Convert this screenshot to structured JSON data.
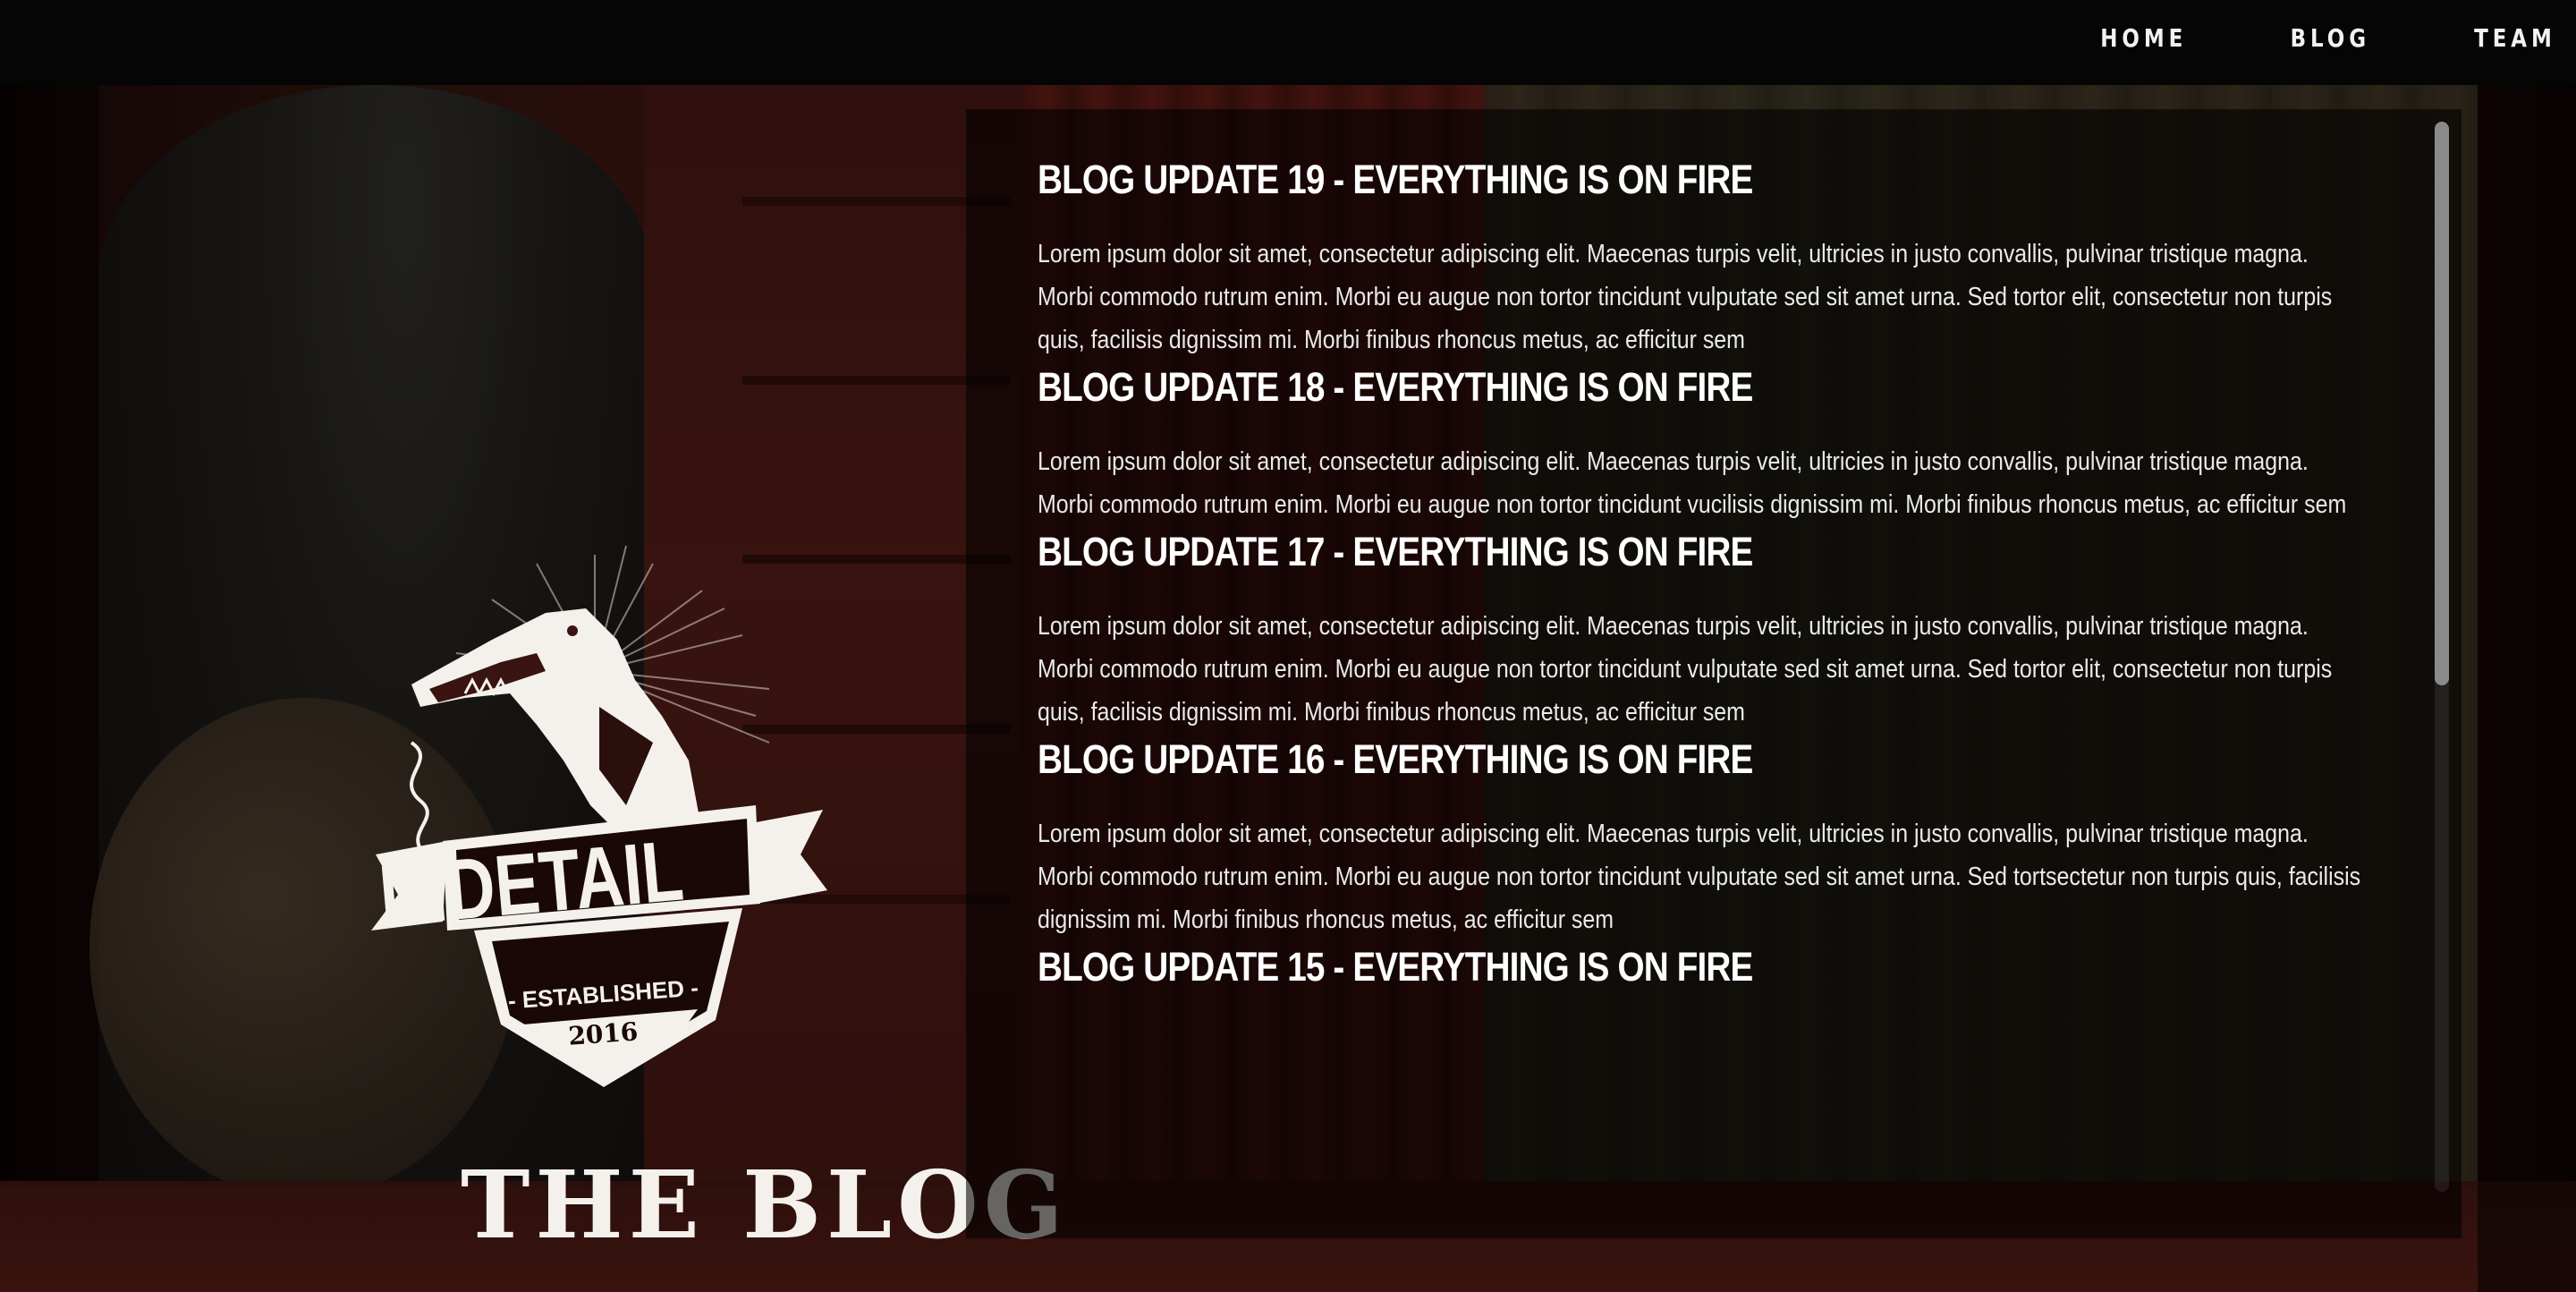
{
  "nav": {
    "home": "HOME",
    "blog": "BLOG",
    "team": "TEAM"
  },
  "logo": {
    "brand": "INDETAIL",
    "established": "- ESTABLISHED -",
    "year": "2016"
  },
  "blog_title": "THE BLOG",
  "posts": [
    {
      "title": "BLOG UPDATE 19 - EVERYTHING IS ON FIRE",
      "body": "Lorem ipsum dolor sit amet, consectetur adipiscing elit. Maecenas turpis velit, ultricies in justo convallis, pulvinar tristique magna. Morbi commodo rutrum enim. Morbi eu augue non tortor tincidunt vulputate sed sit amet urna. Sed tortor elit, consectetur non turpis quis, facilisis dignissim mi. Morbi finibus rhoncus metus, ac efficitur sem"
    },
    {
      "title": "BLOG UPDATE 18 - EVERYTHING IS ON FIRE",
      "body": "Lorem ipsum dolor sit amet, consectetur adipiscing elit. Maecenas turpis velit, ultricies in justo convallis, pulvinar tristique magna. Morbi commodo rutrum enim. Morbi eu augue non tortor tincidunt vucilisis dignissim mi. Morbi finibus rhoncus metus, ac efficitur sem"
    },
    {
      "title": "BLOG UPDATE 17 - EVERYTHING IS ON FIRE",
      "body": "Lorem ipsum dolor sit amet, consectetur adipiscing elit. Maecenas turpis velit, ultricies in justo convallis, pulvinar tristique magna. Morbi commodo rutrum enim. Morbi eu augue non tortor tincidunt vulputate sed sit amet urna. Sed tortor elit, consectetur non turpis quis, facilisis dignissim mi. Morbi finibus rhoncus metus, ac efficitur sem"
    },
    {
      "title": "BLOG UPDATE 16 - EVERYTHING IS ON FIRE",
      "body": "Lorem ipsum dolor sit amet, consectetur adipiscing elit. Maecenas turpis velit, ultricies in justo convallis, pulvinar tristique magna. Morbi commodo rutrum enim. Morbi eu augue non tortor tincidunt vulputate sed sit amet urna. Sed tortsectetur non turpis quis, facilisis dignissim mi. Morbi finibus rhoncus metus, ac efficitur sem"
    },
    {
      "title": "BLOG UPDATE 15 - EVERYTHING IS ON FIRE",
      "body": ""
    }
  ],
  "colors": {
    "topbar": "#050505",
    "text": "#ffffff",
    "panel": "rgba(0,0,0,0.58)"
  }
}
